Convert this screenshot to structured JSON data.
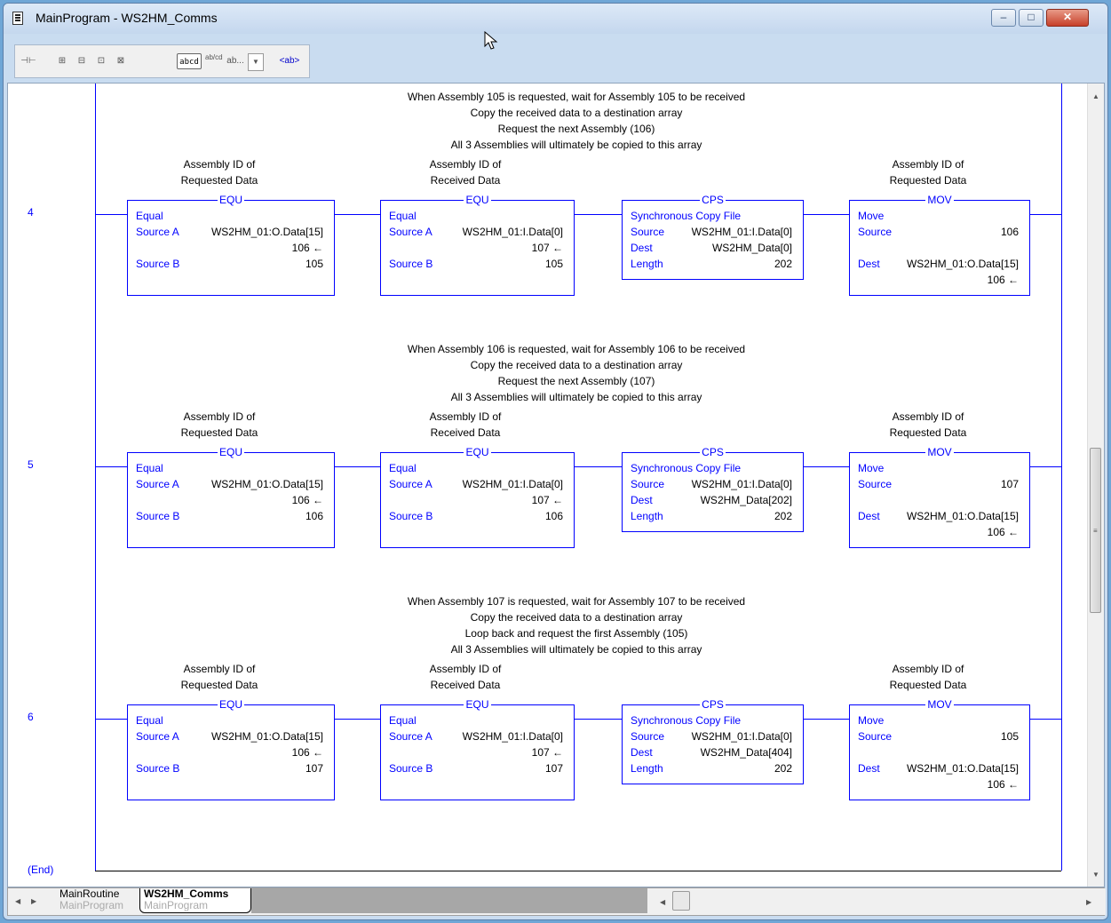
{
  "window": {
    "title": "MainProgram - WS2HM_Comms",
    "buttons": {
      "minimize": "–",
      "maximize": "□",
      "close": "✕"
    }
  },
  "toolbar": {
    "items": [
      "⊣⊢",
      "⊞",
      "⊟",
      "⊡",
      "⊠",
      "abcd",
      "ab/cd",
      "ab...",
      "▼",
      "<ab>"
    ]
  },
  "rungs": [
    {
      "number": "4",
      "comment": [
        "When Assembly 105 is requested, wait for Assembly 105 to be received",
        "Copy the received data to a destination array",
        "Request the next Assembly (106)",
        "All 3 Assemblies will ultimately be copied to this array"
      ],
      "equ1": {
        "label1": "Assembly ID of",
        "label2": "Requested Data",
        "title": "EQU",
        "name": "Equal",
        "src_a_label": "Source A",
        "src_a_tag": "WS2HM_01:O.Data[15]",
        "src_a_value": "106 ←",
        "src_b_label": "Source B",
        "src_b_value": "105"
      },
      "equ2": {
        "label1": "Assembly ID of",
        "label2": "Received Data",
        "title": "EQU",
        "name": "Equal",
        "src_a_label": "Source A",
        "src_a_tag": "WS2HM_01:I.Data[0]",
        "src_a_value": "107 ←",
        "src_b_label": "Source B",
        "src_b_value": "105"
      },
      "cps": {
        "title": "CPS",
        "name": "Synchronous Copy File",
        "source_label": "Source",
        "source_tag": "WS2HM_01:I.Data[0]",
        "dest_label": "Dest",
        "dest_tag": "WS2HM_Data[0]",
        "length_label": "Length",
        "length_value": "202"
      },
      "mov": {
        "label1": "Assembly ID of",
        "label2": "Requested Data",
        "title": "MOV",
        "name": "Move",
        "source_label": "Source",
        "source_value": "106",
        "dest_label": "Dest",
        "dest_tag": "WS2HM_01:O.Data[15]",
        "dest_value": "106 ←"
      }
    },
    {
      "number": "5",
      "comment": [
        "When Assembly 106 is requested, wait for Assembly 106 to be received",
        "Copy the received data to a destination array",
        "Request the next Assembly (107)",
        "All 3 Assemblies will ultimately be copied to this array"
      ],
      "equ1": {
        "label1": "Assembly ID of",
        "label2": "Requested Data",
        "title": "EQU",
        "name": "Equal",
        "src_a_label": "Source A",
        "src_a_tag": "WS2HM_01:O.Data[15]",
        "src_a_value": "106 ←",
        "src_b_label": "Source B",
        "src_b_value": "106"
      },
      "equ2": {
        "label1": "Assembly ID of",
        "label2": "Received Data",
        "title": "EQU",
        "name": "Equal",
        "src_a_label": "Source A",
        "src_a_tag": "WS2HM_01:I.Data[0]",
        "src_a_value": "107 ←",
        "src_b_label": "Source B",
        "src_b_value": "106"
      },
      "cps": {
        "title": "CPS",
        "name": "Synchronous Copy File",
        "source_label": "Source",
        "source_tag": "WS2HM_01:I.Data[0]",
        "dest_label": "Dest",
        "dest_tag": "WS2HM_Data[202]",
        "length_label": "Length",
        "length_value": "202"
      },
      "mov": {
        "label1": "Assembly ID of",
        "label2": "Requested Data",
        "title": "MOV",
        "name": "Move",
        "source_label": "Source",
        "source_value": "107",
        "dest_label": "Dest",
        "dest_tag": "WS2HM_01:O.Data[15]",
        "dest_value": "106 ←"
      }
    },
    {
      "number": "6",
      "comment": [
        "When Assembly 107 is requested, wait for Assembly 107 to be received",
        "Copy the received data to a destination array",
        "Loop back and request the first Assembly (105)",
        "All 3 Assemblies will ultimately be copied to this array"
      ],
      "equ1": {
        "label1": "Assembly ID of",
        "label2": "Requested Data",
        "title": "EQU",
        "name": "Equal",
        "src_a_label": "Source A",
        "src_a_tag": "WS2HM_01:O.Data[15]",
        "src_a_value": "106 ←",
        "src_b_label": "Source B",
        "src_b_value": "107"
      },
      "equ2": {
        "label1": "Assembly ID of",
        "label2": "Received Data",
        "title": "EQU",
        "name": "Equal",
        "src_a_label": "Source A",
        "src_a_tag": "WS2HM_01:I.Data[0]",
        "src_a_value": "107 ←",
        "src_b_label": "Source B",
        "src_b_value": "107"
      },
      "cps": {
        "title": "CPS",
        "name": "Synchronous Copy File",
        "source_label": "Source",
        "source_tag": "WS2HM_01:I.Data[0]",
        "dest_label": "Dest",
        "dest_tag": "WS2HM_Data[404]",
        "length_label": "Length",
        "length_value": "202"
      },
      "mov": {
        "label1": "Assembly ID of",
        "label2": "Requested Data",
        "title": "MOV",
        "name": "Move",
        "source_label": "Source",
        "source_value": "105",
        "dest_label": "Dest",
        "dest_tag": "WS2HM_01:O.Data[15]",
        "dest_value": "106 ←"
      }
    }
  ],
  "end_label": "(End)",
  "tabs": [
    {
      "label": "MainRoutine",
      "sub": "MainProgram"
    },
    {
      "label": "WS2HM_Comms",
      "sub": "MainProgram"
    }
  ]
}
